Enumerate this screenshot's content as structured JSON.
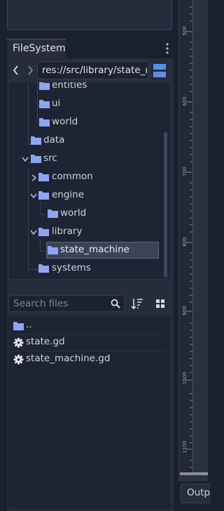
{
  "dock": {
    "tab_label": "FileSystem",
    "path": "res://src/library/state_m",
    "search_placeholder": "Search files"
  },
  "tree": [
    {
      "label": "entities",
      "type": "folder",
      "expanded": false
    },
    {
      "label": "ui",
      "type": "folder",
      "expanded": false
    },
    {
      "label": "world",
      "type": "folder",
      "expanded": false
    },
    {
      "label": "data",
      "type": "folder",
      "expanded": false
    },
    {
      "label": "src",
      "type": "folder",
      "expanded": true
    },
    {
      "label": "common",
      "type": "folder",
      "expanded": false
    },
    {
      "label": "engine",
      "type": "folder",
      "expanded": true
    },
    {
      "label": "world",
      "type": "folder",
      "expanded": false
    },
    {
      "label": "library",
      "type": "folder",
      "expanded": true
    },
    {
      "label": "state_machine",
      "type": "folder",
      "selected": true
    },
    {
      "label": "systems",
      "type": "folder",
      "expanded": false
    }
  ],
  "files": [
    {
      "label": "..",
      "icon": "folder-icon"
    },
    {
      "label": "state.gd",
      "icon": "gear-icon"
    },
    {
      "label": "state_machine.gd",
      "icon": "gear-icon"
    }
  ],
  "ruler_labels": [
    "500",
    "600",
    "700",
    "800",
    "900",
    "1000",
    "1100"
  ],
  "output_tab": "Outp",
  "colors": {
    "folder": "#8da5f3",
    "accent": "#5a8fe8",
    "selection": "#3b4457"
  }
}
